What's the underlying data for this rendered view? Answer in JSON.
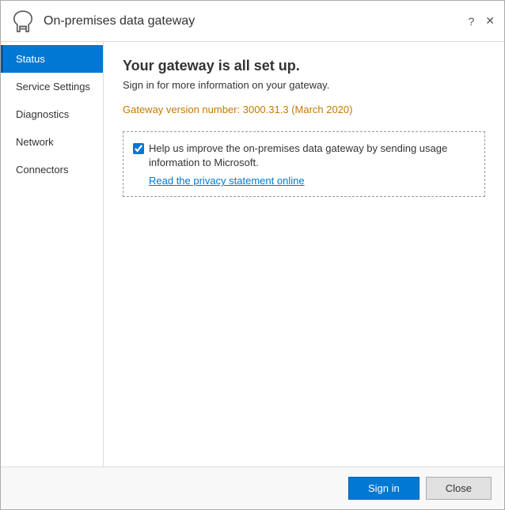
{
  "titleBar": {
    "title": "On-premises data gateway",
    "helpLabel": "?",
    "closeLabel": "✕"
  },
  "sidebar": {
    "items": [
      {
        "id": "status",
        "label": "Status",
        "active": true
      },
      {
        "id": "service-settings",
        "label": "Service Settings",
        "active": false
      },
      {
        "id": "diagnostics",
        "label": "Diagnostics",
        "active": false
      },
      {
        "id": "network",
        "label": "Network",
        "active": false
      },
      {
        "id": "connectors",
        "label": "Connectors",
        "active": false
      }
    ]
  },
  "content": {
    "title": "Your gateway is all set up.",
    "subtitle": "Sign in for more information on your gateway.",
    "gatewayVersionLabel": "Gateway version number: 3000.31.3 ",
    "gatewayVersionDate": "(March 2020)",
    "checkboxLabel": "Help us improve the on-premises data gateway by sending usage information to Microsoft.",
    "checkboxChecked": true,
    "privacyLinkLabel": "Read the privacy statement online"
  },
  "footer": {
    "signInLabel": "Sign in",
    "closeLabel": "Close"
  }
}
